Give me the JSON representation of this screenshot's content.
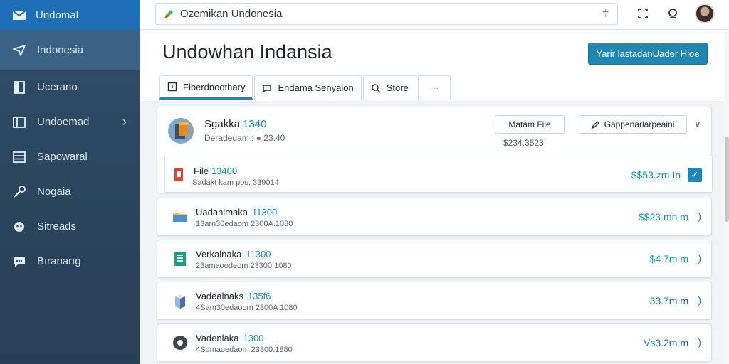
{
  "sidebar": {
    "brand": "Undomal",
    "items": [
      {
        "label": "Indonesia",
        "icon": "plane-icon"
      },
      {
        "label": "Ucerano",
        "icon": "document-icon"
      },
      {
        "label": "Undoemad",
        "icon": "book-icon"
      },
      {
        "label": "Sapowaral",
        "icon": "list-icon"
      },
      {
        "label": "Nogaia",
        "icon": "wrench-icon"
      },
      {
        "label": "Sitreads",
        "icon": "group-icon"
      },
      {
        "label": "Bırariarıg",
        "icon": "chat-icon"
      }
    ]
  },
  "topbar": {
    "search_value": "Ozemikan Undonesia"
  },
  "main": {
    "title": "Undowhan Indansia",
    "primary_button": "Yarir lastadanUader Hloe",
    "tabs": [
      {
        "label": "Fiberdnoothary"
      },
      {
        "label": "Endama Senyaion"
      },
      {
        "label": "Store"
      }
    ],
    "expanded_card": {
      "title": "Sgakka",
      "title_num": "1340",
      "subtitle": "Deradeuam :",
      "subtitle_num": "23.40",
      "file_button": "Matam File",
      "pair_button": "Gappenarlarpeaini",
      "price": "$234.3523",
      "subrow": {
        "title": "File",
        "title_num": "13400",
        "meta": "Sadakt kam pos: 339014",
        "price": "$$53.zm In"
      }
    },
    "rows": [
      {
        "title": "Uadanlmaka",
        "num": "11300",
        "meta": "13arn30edaom 2300A.1080",
        "price": "$$23.mn m",
        "end": ")",
        "icon": "folder-icon",
        "price_style": "teal"
      },
      {
        "title": "Verkalnaka",
        "num": "11300",
        "meta": "23amaoodeom 23300.1080",
        "price": "$4.7m m",
        "end": ")",
        "icon": "document-green-icon",
        "price_style": "teal"
      },
      {
        "title": "Vadealnaks",
        "num": "135f6",
        "meta": "4Sam30edaoom 2300A 1080",
        "price": "33.7m m",
        "end": ")",
        "icon": "box-icon",
        "price_style": "dark"
      },
      {
        "title": "Vadenlaka",
        "num": "1300",
        "meta": "4Sdmaoedaom 23300.1880",
        "price": "Vs3.2m m",
        "end": ")",
        "icon": "circle-icon",
        "price_style": "dark"
      }
    ]
  },
  "colors": {
    "accent": "#1f87b5",
    "sidebar": "#2f4d68",
    "brand_bar": "#1f6fb6",
    "price": "#1796a6"
  }
}
